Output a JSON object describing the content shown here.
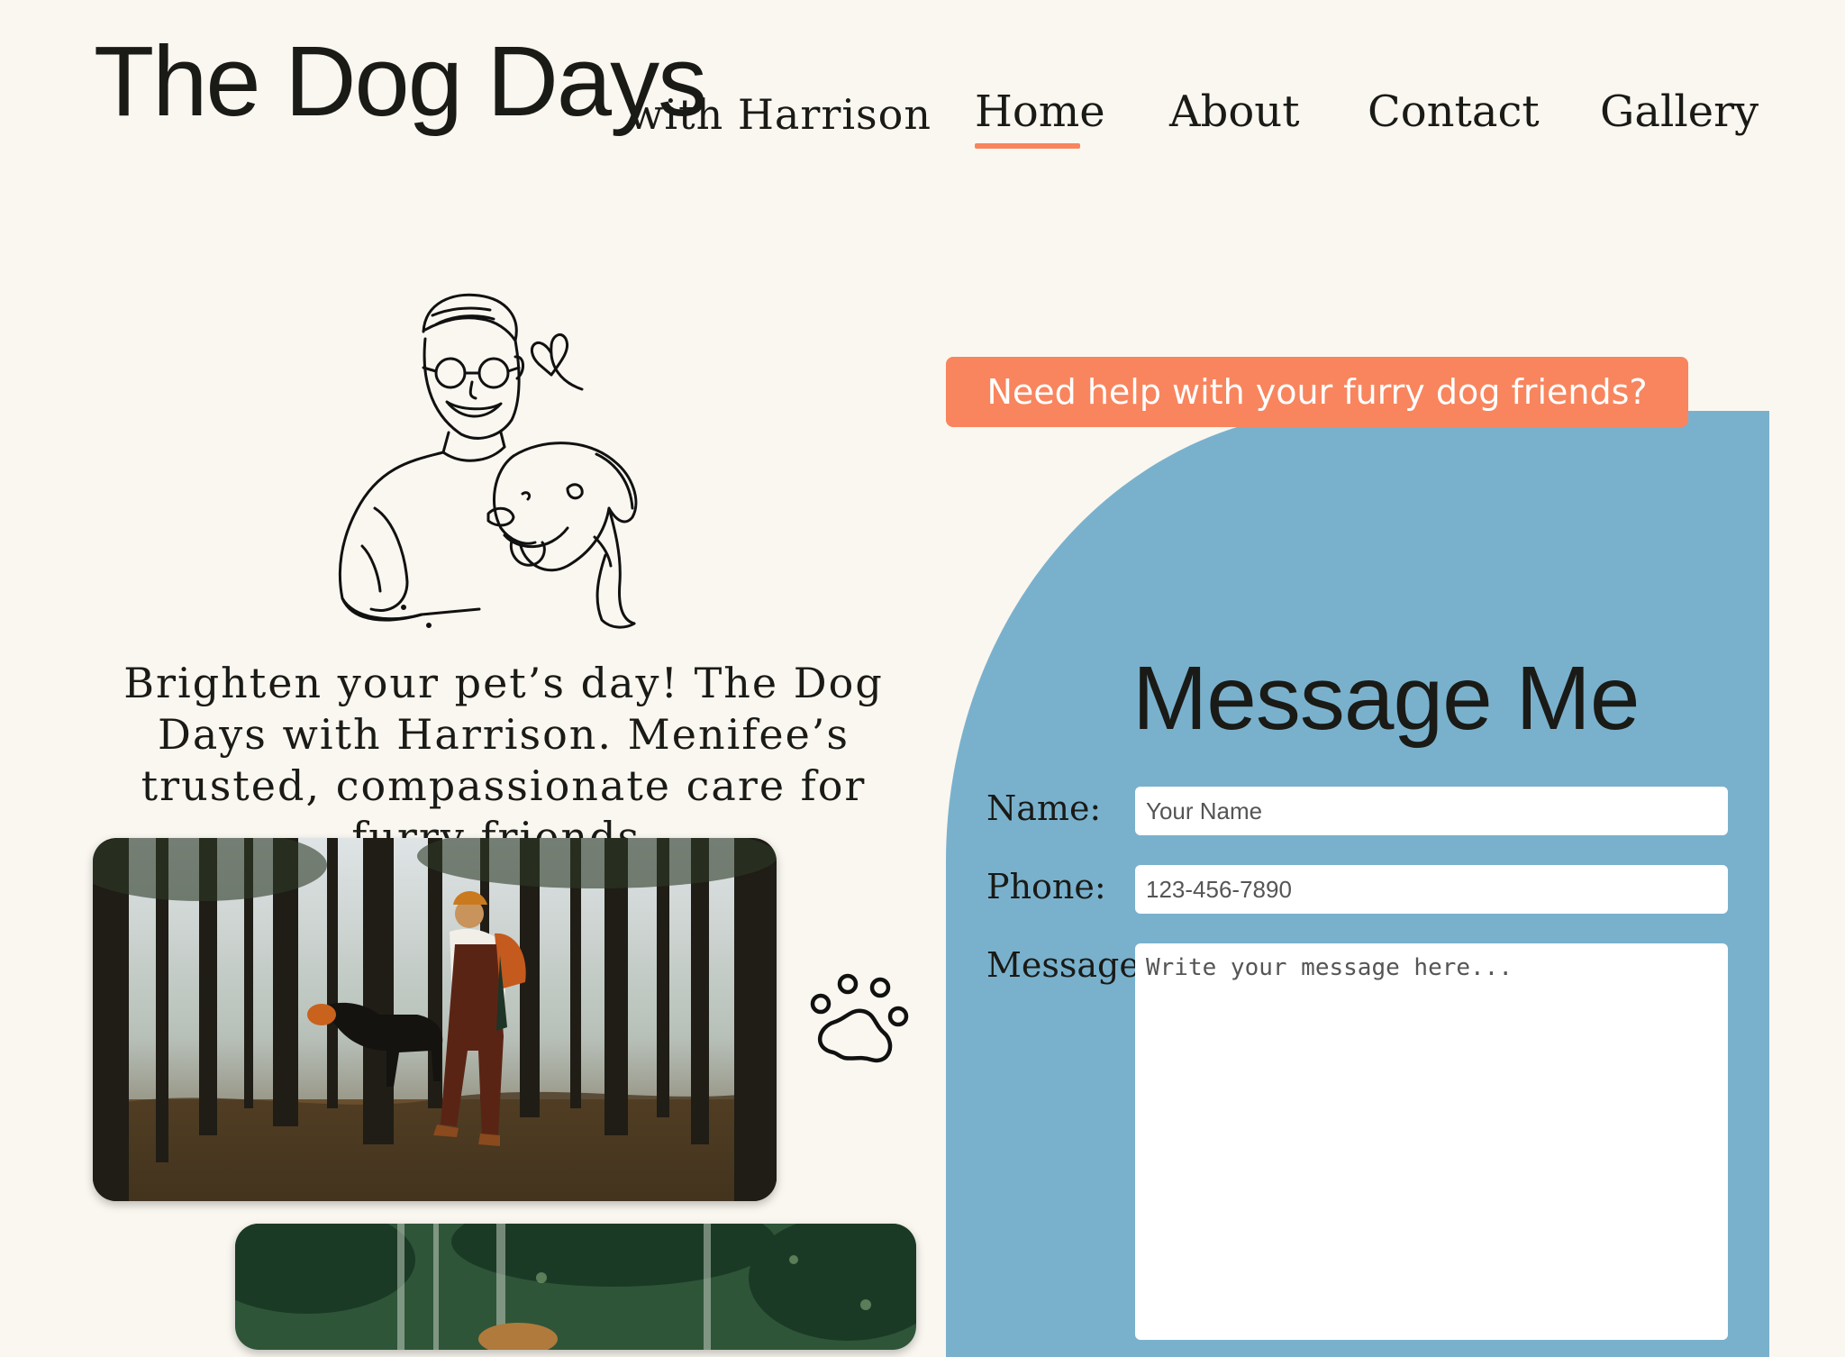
{
  "header": {
    "title": "The Dog Days",
    "subtitle": "with Harrison"
  },
  "nav": {
    "items": [
      {
        "label": "Home",
        "active": true
      },
      {
        "label": "About",
        "active": false
      },
      {
        "label": "Contact",
        "active": false
      },
      {
        "label": "Gallery",
        "active": false
      }
    ],
    "accent_color": "#f8855e"
  },
  "hero": {
    "illustration": "man-with-dog-line-drawing",
    "tagline": "Brighten your pet’s day! The Dog Days with Harrison. Menifee’s trusted, compassionate care for furry friends.",
    "paw_icon": "paw-icon"
  },
  "contact": {
    "banner": "Need help with your furry dog friends?",
    "title": "Message Me",
    "fields": {
      "name": {
        "label": "Name:",
        "placeholder": "Your Name"
      },
      "phone": {
        "label": "Phone:",
        "placeholder": "123-456-7890"
      },
      "message": {
        "label": "Message:",
        "placeholder": "Write your message here..."
      }
    },
    "panel_color": "#79b1cd",
    "banner_color": "#f8855e"
  },
  "colors": {
    "background": "#faf7f0",
    "text": "#1a1a16"
  }
}
